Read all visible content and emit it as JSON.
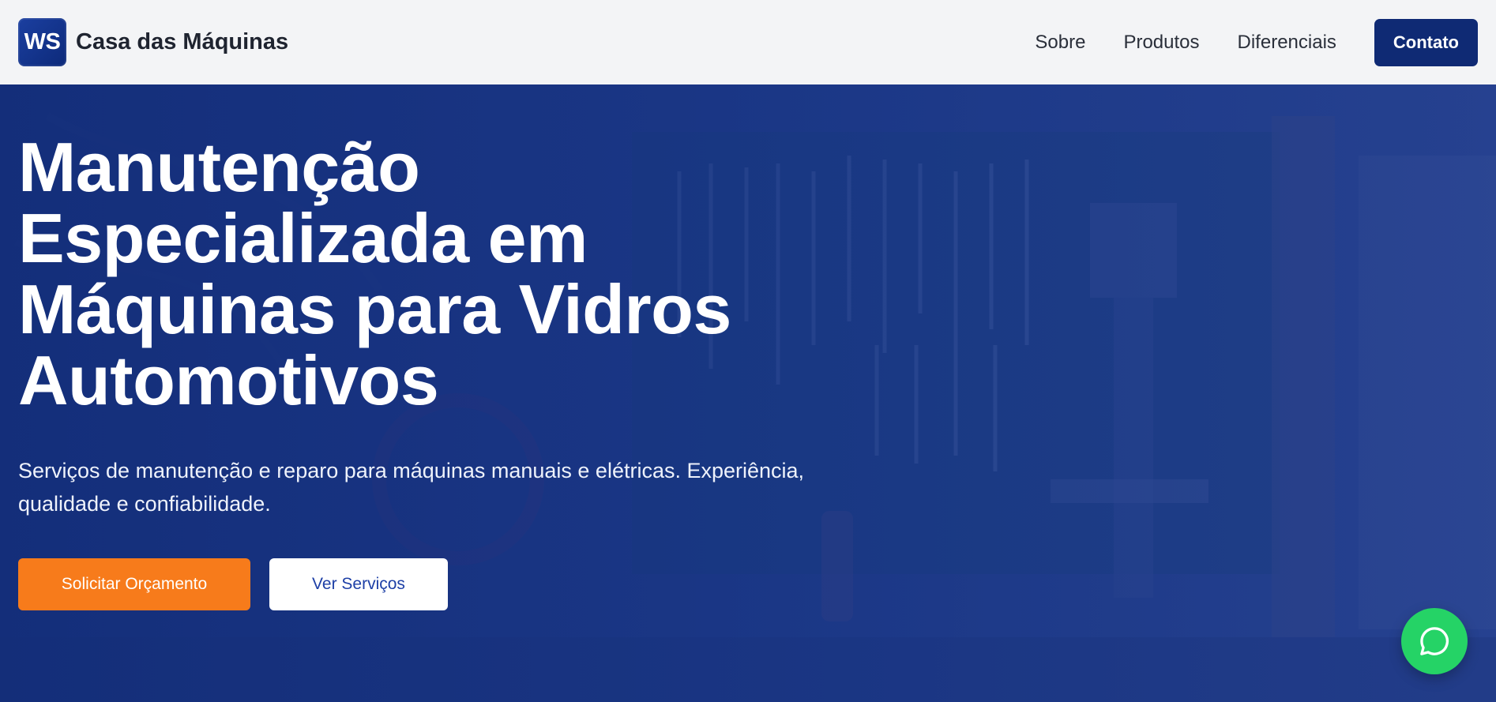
{
  "header": {
    "logo_text": "WS",
    "brand": "Casa das Máquinas",
    "nav": [
      "Sobre",
      "Produtos",
      "Diferenciais"
    ],
    "contact_label": "Contato"
  },
  "hero": {
    "title_lines": [
      "Manutenção",
      "Especializada em",
      "Máquinas para Vidros",
      "Automotivos"
    ],
    "subtitle": "Serviços de manutenção e reparo para máquinas manuais e elétricas. Experiência, qualidade e confiabilidade.",
    "primary_cta": "Solicitar Orçamento",
    "secondary_cta": "Ver Serviços"
  },
  "floating": {
    "whatsapp_icon": "whatsapp-icon"
  },
  "colors": {
    "header_bg": "#f3f4f6",
    "brand_dark": "#0f2a74",
    "hero_overlay": "#13307a",
    "accent_orange": "#f77b1b",
    "whatsapp_green": "#25d366"
  }
}
